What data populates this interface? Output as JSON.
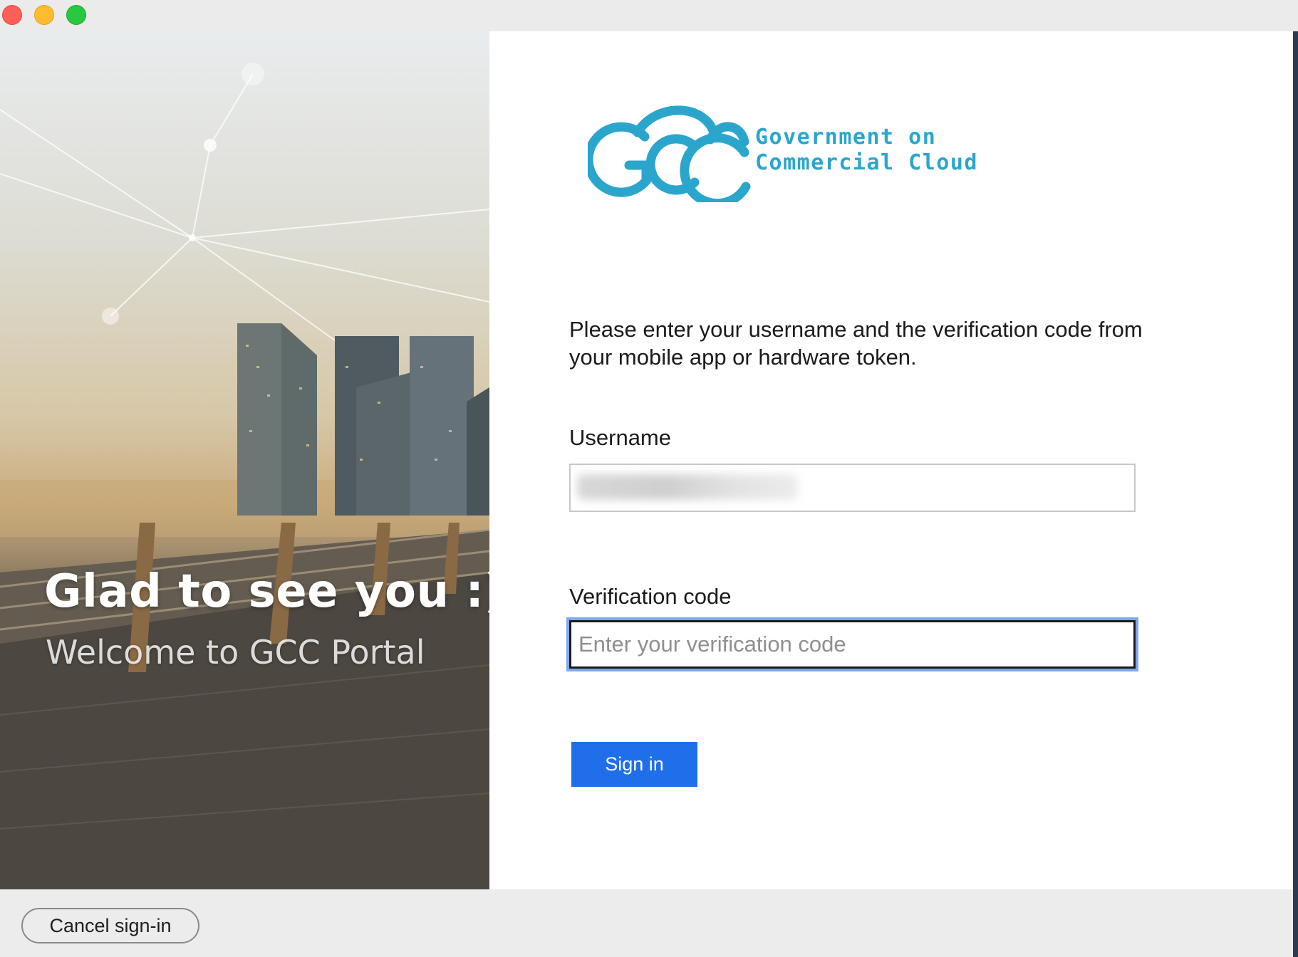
{
  "window": {
    "controls": [
      "close",
      "minimize",
      "maximize"
    ]
  },
  "hero": {
    "title": "Glad to see you :)",
    "subtitle": "Welcome to GCC Portal"
  },
  "logo": {
    "mark": "GCC",
    "line1": "Government on",
    "line2": "Commercial Cloud",
    "color": "#2aa6cc"
  },
  "form": {
    "instructions": "Please enter your username and the verification code from your mobile app or hardware token.",
    "username_label": "Username",
    "username_value": "",
    "code_label": "Verification code",
    "code_placeholder": "Enter your verification code",
    "submit_label": "Sign in"
  },
  "footer": {
    "cancel_label": "Cancel sign-in"
  },
  "colors": {
    "primary": "#1f6feb",
    "focus_ring": "#7ea7ef"
  }
}
